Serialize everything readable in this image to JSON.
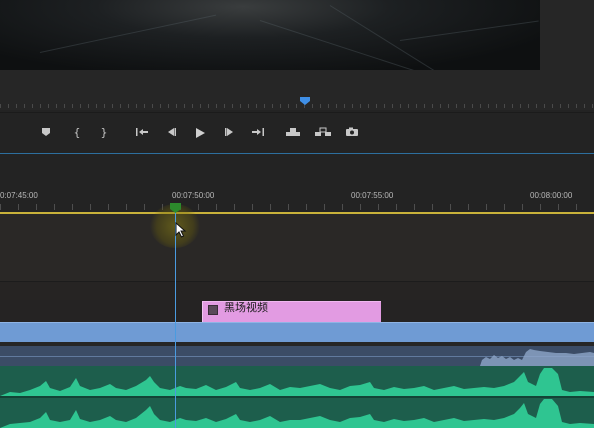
{
  "transport": {
    "buttons": [
      {
        "name": "add-marker",
        "icon": "marker-icon"
      },
      {
        "name": "mark-in",
        "label": "{",
        "icon": "mark-in-icon"
      },
      {
        "name": "mark-out",
        "label": "}",
        "icon": "mark-out-icon"
      },
      {
        "name": "go-to-in",
        "icon": "go-to-in-icon"
      },
      {
        "name": "step-back",
        "icon": "step-back-icon"
      },
      {
        "name": "play",
        "icon": "play-icon"
      },
      {
        "name": "step-forward",
        "icon": "step-forward-icon"
      },
      {
        "name": "go-to-out",
        "icon": "go-to-out-icon"
      },
      {
        "name": "lift",
        "icon": "lift-icon"
      },
      {
        "name": "extract",
        "icon": "extract-icon"
      },
      {
        "name": "export-frame",
        "icon": "camera-icon"
      }
    ]
  },
  "timeline": {
    "timecodes": [
      "0:07:45:00",
      "00:07:50:00",
      "00:07:55:00",
      "00:08:00:00"
    ],
    "clip_label": "黑场视频"
  },
  "colors": {
    "accent_blue": "#4a9be0",
    "work_area": "#c9b23a",
    "clip_pink": "#e29be2",
    "audio_green": "#1d5e4c",
    "video_blue": "#6f9bd4"
  }
}
